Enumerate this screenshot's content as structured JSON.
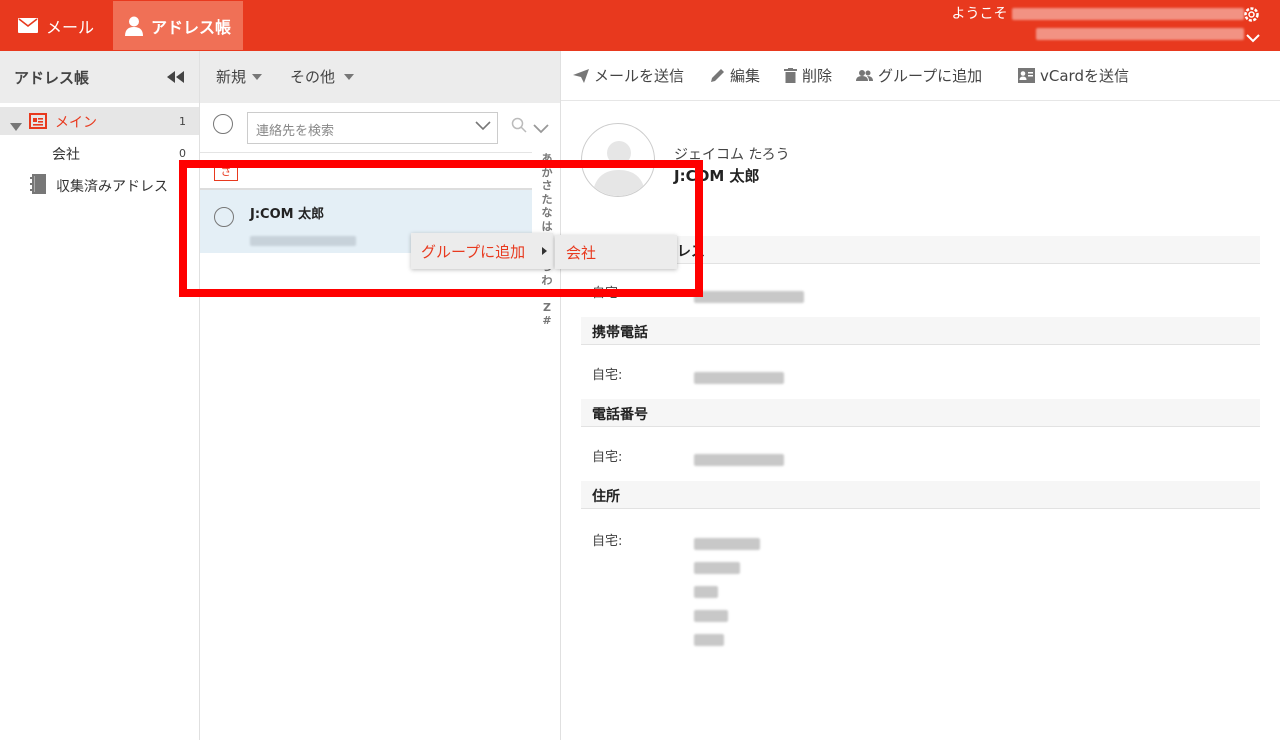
{
  "topbar": {
    "mail_label": "メール",
    "addressbook_label": "アドレス帳",
    "welcome_label": "ようこそ"
  },
  "left": {
    "title": "アドレス帳",
    "tree": {
      "main_label": "メイン",
      "main_count": "1",
      "sub_label": "会社",
      "sub_count": "0",
      "collected_label": "収集済みアドレス"
    }
  },
  "middle": {
    "new_label": "新規",
    "other_label": "その他",
    "search_placeholder": "連絡先を検索",
    "kana_header": "さ",
    "contact_name": "J:COM 太郎",
    "index_chars": [
      "あ",
      "か",
      "さ",
      "た",
      "な",
      "は",
      "ま",
      "や",
      "ら",
      "わ",
      "A-Z",
      "#"
    ]
  },
  "context_menu": {
    "item_label": "グループに追加",
    "submenu_item": "会社"
  },
  "right": {
    "toolbar": {
      "send_mail": "メールを送信",
      "edit": "編集",
      "delete": "削除",
      "add_group": "グループに追加",
      "send_vcard": "vCardを送信"
    },
    "contact": {
      "name_kana": "ジェイコム たろう",
      "name": "J:COM 太郎"
    },
    "sections": {
      "email_partial": "レス",
      "mobile": "携帯電話",
      "phone": "電話番号",
      "address": "住所"
    },
    "field_label_home": "自宅:"
  },
  "colors": {
    "accent": "#e8391e",
    "active_tab": "#f07056",
    "highlight": "#ff0000"
  }
}
